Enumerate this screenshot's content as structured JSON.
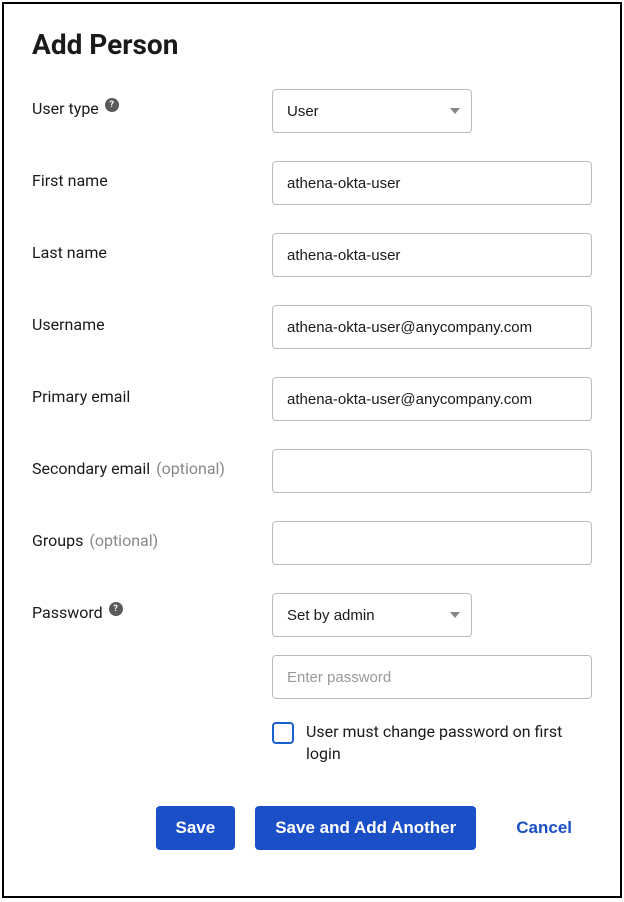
{
  "title": "Add Person",
  "fields": {
    "userType": {
      "label": "User type",
      "value": "User"
    },
    "firstName": {
      "label": "First name",
      "value": "athena-okta-user"
    },
    "lastName": {
      "label": "Last name",
      "value": "athena-okta-user"
    },
    "username": {
      "label": "Username",
      "value": "athena-okta-user@anycompany.com"
    },
    "primaryEmail": {
      "label": "Primary email",
      "value": "athena-okta-user@anycompany.com"
    },
    "secondaryEmail": {
      "label": "Secondary email ",
      "optional": "(optional)",
      "value": ""
    },
    "groups": {
      "label": "Groups ",
      "optional": "(optional)",
      "value": ""
    },
    "password": {
      "label": "Password",
      "mode": "Set by admin",
      "placeholder": "Enter password",
      "checkboxLabel": "User must change password on first login"
    }
  },
  "buttons": {
    "save": "Save",
    "saveAddAnother": "Save and Add Another",
    "cancel": "Cancel"
  }
}
